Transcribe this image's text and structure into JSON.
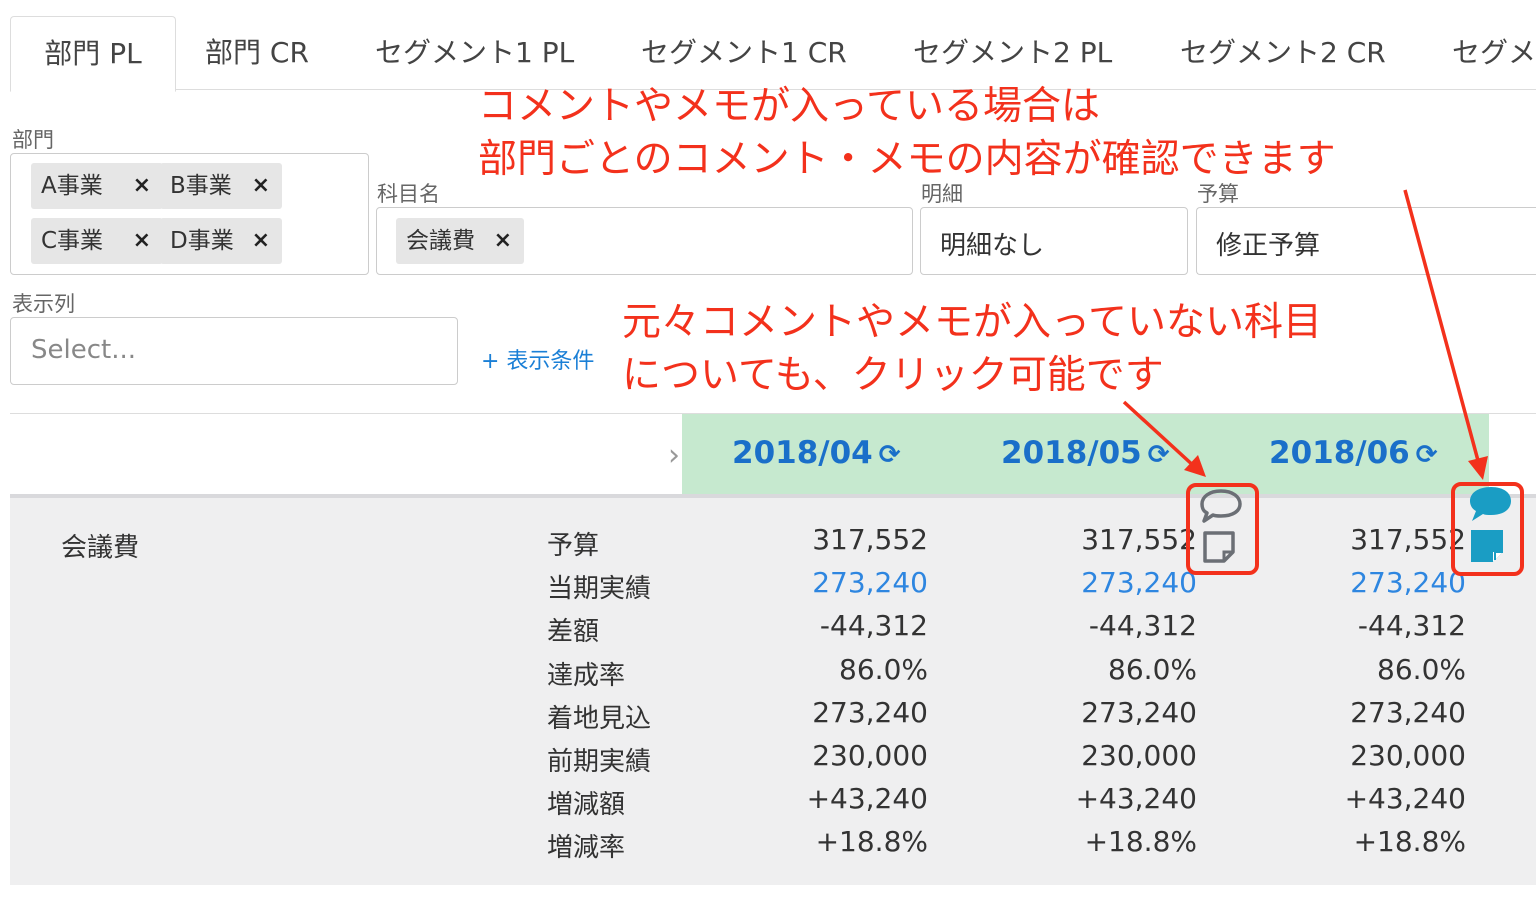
{
  "tabs": [
    {
      "label": "部門 PL",
      "active": true
    },
    {
      "label": "部門 CR"
    },
    {
      "label": "セグメント1 PL"
    },
    {
      "label": "セグメント1 CR"
    },
    {
      "label": "セグメント2 PL"
    },
    {
      "label": "セグメント2 CR"
    },
    {
      "label": "セグメ"
    }
  ],
  "filters": {
    "department": {
      "label": "部門",
      "chips": [
        "A事業",
        "B事業",
        "C事業",
        "D事業"
      ]
    },
    "account": {
      "label": "科目名",
      "chips": [
        "会議費"
      ]
    },
    "detail": {
      "label": "明細",
      "value": "明細なし"
    },
    "budget": {
      "label": "予算",
      "value": "修正予算"
    },
    "columns": {
      "label": "表示列",
      "placeholder": "Select..."
    },
    "add_condition": "+ 表示条件",
    "remove_glyph": "×"
  },
  "header": {
    "nav_arrow": "›",
    "refresh_glyph": "⟳",
    "periods": [
      "2018/04",
      "2018/05",
      "2018/06"
    ]
  },
  "table": {
    "account_name": "会議費",
    "row_labels": [
      "予算",
      "当期実績",
      "差額",
      "達成率",
      "着地見込",
      "前期実績",
      "増減額",
      "増減率"
    ],
    "columns": [
      [
        "317,552",
        "273,240",
        "-44,312",
        "86.0%",
        "273,240",
        "230,000",
        "+43,240",
        "+18.8%"
      ],
      [
        "317,552",
        "273,240",
        "-44,312",
        "86.0%",
        "273,240",
        "230,000",
        "+43,240",
        "+18.8%"
      ],
      [
        "317,552",
        "273,240",
        "-44,312",
        "86.0%",
        "273,240",
        "230,000",
        "+43,240",
        "+18.8%"
      ]
    ]
  },
  "annotations": {
    "top_line1": "コメントやメモが入っている場合は",
    "top_line2": "部門ごとのコメント・メモの内容が確認できます",
    "mid_line1": "元々コメントやメモが入っていない科目",
    "mid_line2": "についても、クリック可能です"
  },
  "colors": {
    "accent_red": "#f3311c",
    "period_band": "#c6e9cf",
    "link_blue": "#1a7fd6",
    "teal_icon": "#1a9dc4"
  }
}
